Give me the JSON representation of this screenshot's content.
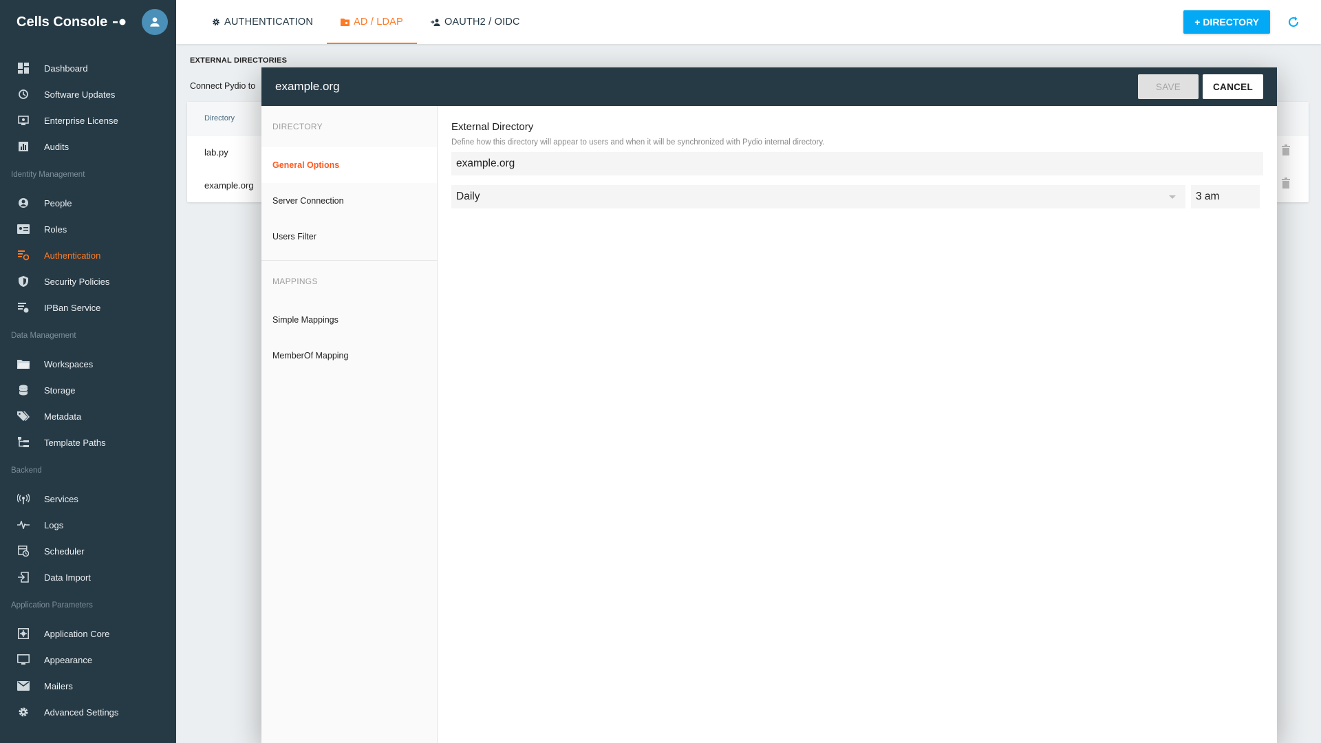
{
  "sidebar": {
    "title": "Cells Console",
    "groups": [
      {
        "section": "",
        "items": [
          {
            "label": "Dashboard",
            "icon": "dashboard-icon"
          },
          {
            "label": "Software Updates",
            "icon": "update-icon"
          },
          {
            "label": "Enterprise License",
            "icon": "license-icon"
          },
          {
            "label": "Audits",
            "icon": "audits-icon"
          }
        ]
      },
      {
        "section": "Identity Management",
        "items": [
          {
            "label": "People",
            "icon": "person-icon"
          },
          {
            "label": "Roles",
            "icon": "roles-icon"
          },
          {
            "label": "Authentication",
            "icon": "authentication-icon",
            "active": true
          },
          {
            "label": "Security Policies",
            "icon": "shield-icon"
          },
          {
            "label": "IPBan Service",
            "icon": "ipban-icon"
          }
        ]
      },
      {
        "section": "Data Management",
        "items": [
          {
            "label": "Workspaces",
            "icon": "folder-icon"
          },
          {
            "label": "Storage",
            "icon": "storage-icon"
          },
          {
            "label": "Metadata",
            "icon": "tags-icon"
          },
          {
            "label": "Template Paths",
            "icon": "template-paths-icon"
          }
        ]
      },
      {
        "section": "Backend",
        "items": [
          {
            "label": "Services",
            "icon": "services-icon"
          },
          {
            "label": "Logs",
            "icon": "logs-icon"
          },
          {
            "label": "Scheduler",
            "icon": "scheduler-icon"
          },
          {
            "label": "Data Import",
            "icon": "import-icon"
          }
        ]
      },
      {
        "section": "Application Parameters",
        "items": [
          {
            "label": "Application Core",
            "icon": "app-core-icon"
          },
          {
            "label": "Appearance",
            "icon": "monitor-icon"
          },
          {
            "label": "Mailers",
            "icon": "mail-icon"
          },
          {
            "label": "Advanced Settings",
            "icon": "gear-icon"
          }
        ]
      }
    ]
  },
  "topbar": {
    "tabs": [
      {
        "label": "AUTHENTICATION",
        "icon": "gear-icon"
      },
      {
        "label": "AD / LDAP",
        "icon": "ldap-icon",
        "active": true
      },
      {
        "label": "OAUTH2 / OIDC",
        "icon": "oauth-icon"
      }
    ],
    "add_button": "+ DIRECTORY"
  },
  "background": {
    "heading": "EXTERNAL DIRECTORIES",
    "description": "Connect Pydio to",
    "table_header": "Directory",
    "rows": [
      "lab.py",
      "example.org"
    ]
  },
  "modal": {
    "title": "example.org",
    "save_label": "SAVE",
    "cancel_label": "CANCEL",
    "nav": {
      "directory_section": "DIRECTORY",
      "directory_items": [
        "General Options",
        "Server Connection",
        "Users Filter"
      ],
      "mappings_section": "MAPPINGS",
      "mappings_items": [
        "Simple Mappings",
        "MemberOf Mapping"
      ]
    },
    "form": {
      "title": "External Directory",
      "description": "Define how this directory will appear to users and when it will be synchronized with Pydio internal directory.",
      "name_value": "example.org",
      "frequency_value": "Daily",
      "time_value": "3 am"
    }
  },
  "colors": {
    "sidebar_bg": "#263a46",
    "accent": "#ff7a25",
    "primary_button": "#03a9f4"
  }
}
